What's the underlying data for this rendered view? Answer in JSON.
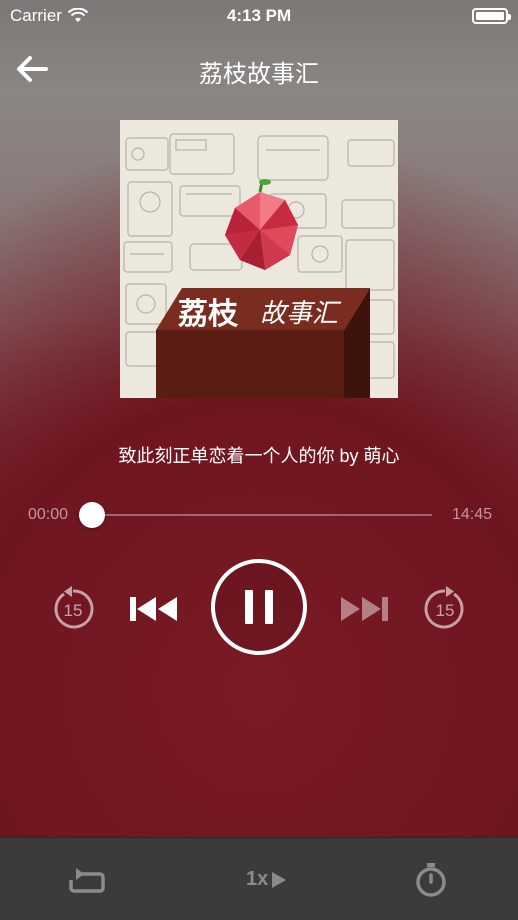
{
  "status": {
    "carrier": "Carrier",
    "time": "4:13 PM"
  },
  "nav": {
    "title": "荔枝故事汇"
  },
  "cover": {
    "brand_text": "荔枝",
    "brand_script": "故事汇"
  },
  "track": {
    "title": "致此刻正单恋着一个人的你 by 萌心"
  },
  "progress": {
    "current": "00:00",
    "total": "14:45",
    "fraction": 0.0
  },
  "controls": {
    "skip_back_seconds": "15",
    "skip_forward_seconds": "15"
  },
  "bottom": {
    "speed": "1x"
  },
  "icons": [
    "back-arrow-icon",
    "wifi-icon",
    "battery-icon",
    "rewind-15-icon",
    "previous-icon",
    "pause-icon",
    "next-icon",
    "forward-15-icon",
    "repeat-icon",
    "play-icon",
    "timer-icon"
  ],
  "colors": {
    "accent": "#6f1a24",
    "bottom_bar": "#3b3b3b",
    "disabled": "#8b8b8b"
  }
}
